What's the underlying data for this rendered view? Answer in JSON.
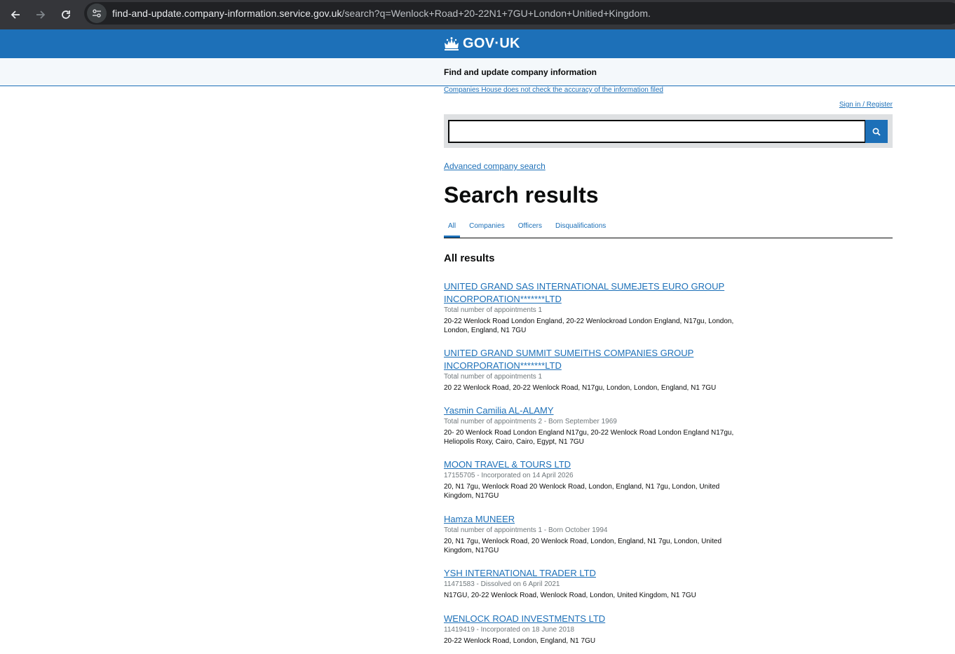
{
  "browser": {
    "url_host": "find-and-update.company-information.service.gov.uk",
    "url_path": "/search?q=Wenlock+Road+20-22N1+7GU+London+Unitied+Kingdom."
  },
  "header": {
    "logo_text": "GOV·UK",
    "service_name": "Find and update company information"
  },
  "links": {
    "accuracy": "Companies House does not check the accuracy of the information filed",
    "signin": "Sign in / Register",
    "advanced": "Advanced company search"
  },
  "search": {
    "value": "",
    "button_icon": "search-icon"
  },
  "page": {
    "title": "Search results",
    "results_heading": "All results"
  },
  "tabs": [
    {
      "label": "All",
      "active": true
    },
    {
      "label": "Companies",
      "active": false
    },
    {
      "label": "Officers",
      "active": false
    },
    {
      "label": "Disqualifications",
      "active": false
    }
  ],
  "results": [
    {
      "title": "UNITED GRAND SAS INTERNATIONAL SUMEJETS EURO GROUP INCORPORATION*******LTD",
      "meta": "Total number of appointments 1",
      "address": "20-22 Wenlock Road London England, 20-22 Wenlockroad London England, N17gu, London, London, England, N1 7GU"
    },
    {
      "title": "UNITED GRAND SUMMIT SUMEITHS COMPANIES GROUP INCORPORATION*******LTD",
      "meta": "Total number of appointments 1",
      "address": "20 22 Wenlock Road, 20-22 Wenlock Road, N17gu, London, London, England, N1 7GU"
    },
    {
      "title": "Yasmin Camilia AL-ALAMY",
      "meta": "Total number of appointments 2 - Born September 1969",
      "address": "20- 20 Wenlock Road London England N17gu, 20-22 Wenlock Road London England N17gu, Heliopolis Roxy, Cairo, Cairo, Egypt, N1 7GU"
    },
    {
      "title": "MOON TRAVEL & TOURS LTD",
      "meta": "17155705 - Incorporated on 14 April 2026",
      "address": "20, N1 7gu, Wenlock Road 20 Wenlock Road, London, England, N1 7gu, London, United Kingdom, N17GU"
    },
    {
      "title": "Hamza MUNEER",
      "meta": "Total number of appointments 1 - Born October 1994",
      "address": "20, N1 7gu, Wenlock Road, 20 Wenlock Road, London, England, N1 7gu, London, United Kingdom, N17GU"
    },
    {
      "title": "YSH INTERNATIONAL TRADER LTD",
      "meta": "11471583 - Dissolved on 6 April 2021",
      "address": "N17GU, 20-22 Wenlock Road, Wenlock Road, London, United Kingdom, N1 7GU"
    },
    {
      "title": "WENLOCK ROAD INVESTMENTS LTD",
      "meta": "11419419 - Incorporated on 18 June 2018",
      "address": "20-22 Wenlock Road, London, England, N1 7GU"
    }
  ]
}
